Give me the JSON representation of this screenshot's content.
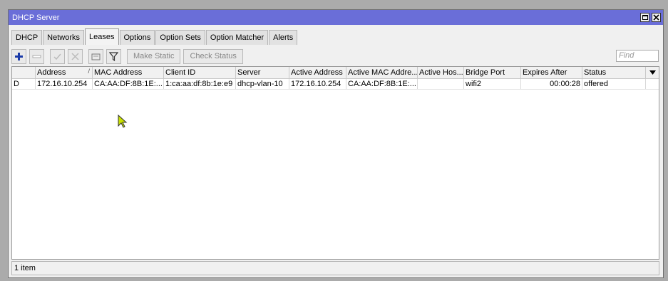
{
  "window": {
    "title": "DHCP Server"
  },
  "tabs": [
    {
      "label": "DHCP"
    },
    {
      "label": "Networks"
    },
    {
      "label": "Leases",
      "active": true
    },
    {
      "label": "Options"
    },
    {
      "label": "Option Sets"
    },
    {
      "label": "Option Matcher"
    },
    {
      "label": "Alerts"
    }
  ],
  "toolbar": {
    "icons": [
      "add-icon",
      "remove-icon",
      "enable-icon",
      "disable-icon",
      "comment-icon",
      "filter-icon"
    ],
    "make_static": "Make Static",
    "check_status": "Check Status",
    "find_placeholder": "Find"
  },
  "table": {
    "columns": [
      "",
      "Address",
      "MAC Address",
      "Client ID",
      "Server",
      "Active Address",
      "Active MAC Addre...",
      "Active Hos...",
      "Bridge Port",
      "Expires After",
      "Status"
    ],
    "sort_column": "Address",
    "rows": [
      {
        "flag": "D",
        "address": "172.16.10.254",
        "mac": "CA:AA:DF:8B:1E:...",
        "client_id": "1:ca:aa:df:8b:1e:e9",
        "server": "dhcp-vlan-10",
        "active_address": "172.16.10.254",
        "active_mac": "CA:AA:DF:8B:1E:...",
        "active_host": "",
        "bridge_port": "wifi2",
        "expires_after": "00:00:28",
        "status": "offered"
      }
    ]
  },
  "status_bar": {
    "count": "1 item"
  },
  "colors": {
    "titlebar": "#6a6ed8",
    "add_icon": "#1a3aa8",
    "cursor": "#c8e000"
  }
}
